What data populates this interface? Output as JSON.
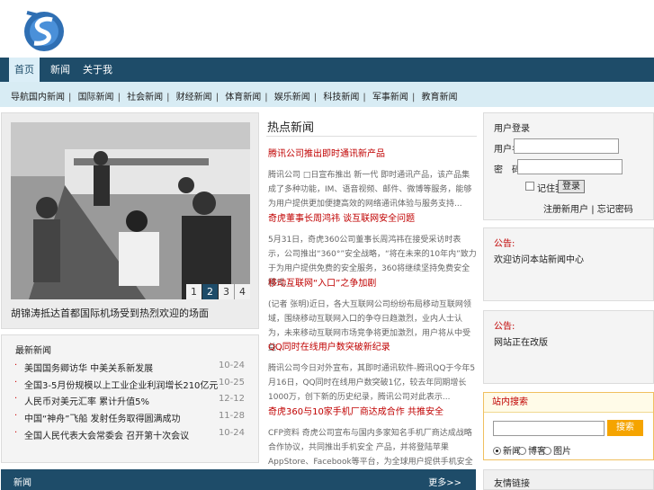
{
  "nav": {
    "items": [
      {
        "label": "首页",
        "active": true
      },
      {
        "label": "新闻",
        "active": false
      },
      {
        "label": "关于我",
        "active": false
      }
    ]
  },
  "subnav": {
    "label": "导航:",
    "items": [
      "国内新闻",
      "国际新闻",
      "社会新闻",
      "财经新闻",
      "体育新闻",
      "娱乐新闻",
      "科技新闻",
      "军事新闻",
      "教育新闻"
    ]
  },
  "slider": {
    "pages": [
      "1",
      "2",
      "3",
      "4"
    ],
    "active_page": "2",
    "caption": "胡锦涛抵达首都国际机场受到热烈欢迎的场面"
  },
  "news_list": {
    "title": "最新新闻",
    "items": [
      {
        "text": "美国国务卿访华 中美关系新发展",
        "date": "10-24"
      },
      {
        "text": "全国3-5月份规模以上工业企业利润增长210亿元",
        "date": "10-25"
      },
      {
        "text": "人民币对美元汇率 累计升值5%",
        "date": "12-12"
      },
      {
        "text": "中国“神舟”飞船 发射任务取得圆满成功",
        "date": "11-28"
      },
      {
        "text": "全国人民代表大会常委会 召开第十次会议",
        "date": "10-24"
      }
    ]
  },
  "center": {
    "title": "热点新闻",
    "articles": [
      {
        "title": "腾讯公司推出即时通讯新产品",
        "body": "腾讯公司 □日宣布推出 新一代 即时通讯产品，该产品集成了多种功能，IM、语音视频、邮件、微博等服务，能够为用户提供更加便捷高效的网络通讯体验与服务支持..."
      },
      {
        "title": "奇虎董事长周鸿祎 谈互联网安全问题",
        "body": "5月31日，奇虎360公司董事长周鸿祎在接受采访时表示，公司推出“360°”安全战略，“将在未来的10年内”致力于为用户提供免费的安全服务，360将继续坚持免费安全模式..."
      },
      {
        "title": "移动互联网“入口”之争加剧",
        "body": "(记者 张明)近日，各大互联网公司纷纷布局移动互联网领域，围绕移动互联网入口的争夺日趋激烈，业内人士认为，未来移动互联网市场竞争将更加激烈，用户将从中受益..."
      },
      {
        "title": "QQ同时在线用户数突破新纪录",
        "body": "腾讯公司今日对外宣布，其即时通讯软件-腾讯QQ于今年5月16日，QQ同时在线用户数突破1亿，较去年同期增长1000万，创下新的历史纪录，腾讯公司对此表示..."
      },
      {
        "title": "奇虎360与10家手机厂商达成合作 共推安全",
        "body": "CFP资料 奇虎公司宣布与国内多家知名手机厂商达成战略合作协议，共同推出手机安全 产品，并将登陆苹果AppStore、Facebook等平台，为全球用户提供手机安全服务与保护..."
      }
    ]
  },
  "login": {
    "title": "用户登录",
    "username_label": "用户名:",
    "password_label": "密　码:",
    "remember_label": "记住我",
    "submit_label": "登录",
    "register_link": "注册新用户",
    "forgot_link": "忘记密码",
    "separator": "|"
  },
  "notice1": {
    "title": "公告:",
    "body": "欢迎访问本站新闻中心"
  },
  "notice2": {
    "title": "公告:",
    "body": "网站正在改版"
  },
  "site_search": {
    "title": "站内搜索",
    "button": "搜索",
    "options": [
      {
        "label": "新闻",
        "checked": true
      },
      {
        "label": "博客",
        "checked": false
      },
      {
        "label": "图片",
        "checked": false
      }
    ]
  },
  "bottom": {
    "label": "新闻",
    "more": "更多>>",
    "right_label": "友情链接"
  },
  "colors": {
    "nav": "#1e4c69",
    "subnav": "#d8ecf4",
    "accent": "#c00000",
    "search_button": "#f5a400"
  }
}
